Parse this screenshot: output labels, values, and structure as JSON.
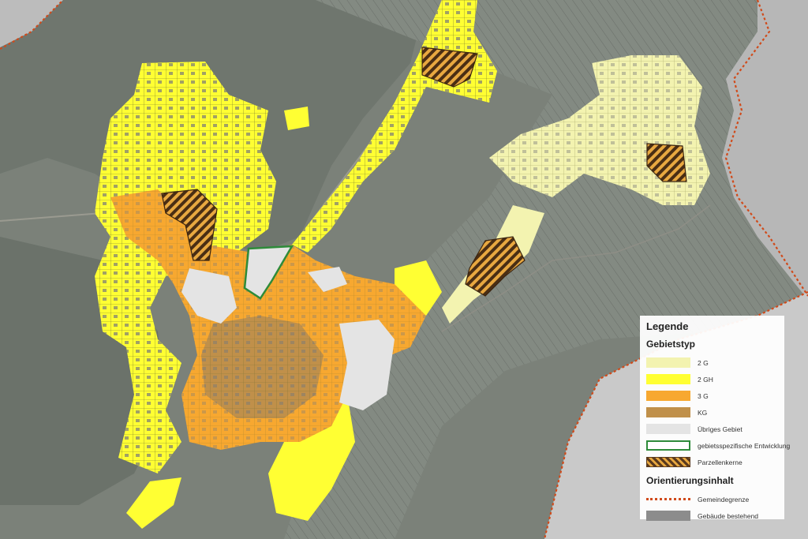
{
  "legend": {
    "title": "Legende",
    "section_zones": "Gebietstyp",
    "section_orientation": "Orientierungsinhalt",
    "zones": [
      {
        "label": "2 G",
        "color": "#f3f3b0"
      },
      {
        "label": "2 GH",
        "color": "#ffff33"
      },
      {
        "label": "3 G",
        "color": "#f7a830"
      },
      {
        "label": "KG",
        "color": "#c0904a"
      },
      {
        "label": "Übriges Gebiet",
        "color": "#e4e4e4"
      },
      {
        "label": "gebietsspezifische Entwicklung",
        "color": "#2e8b3a"
      },
      {
        "label": "Parzellenkerne",
        "color": "#5a3a1e"
      }
    ],
    "orientation": [
      {
        "label": "Gemeindegrenze",
        "color": "#d04a1a"
      },
      {
        "label": "Gebäude bestehend",
        "color": "#8c8c8c"
      }
    ]
  }
}
